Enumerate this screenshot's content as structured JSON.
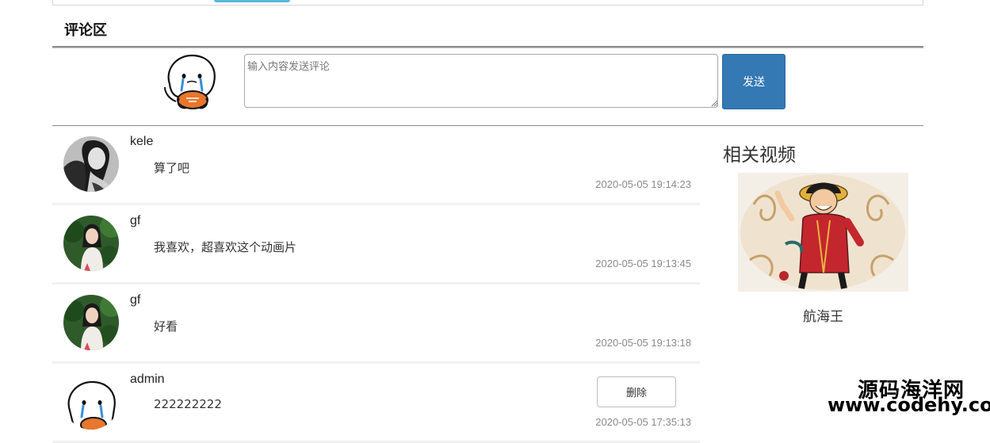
{
  "comment_section": {
    "title": "评论区",
    "input_placeholder": "输入内容发送评论",
    "send_label": "发送"
  },
  "comments": [
    {
      "user": "kele",
      "text": "算了吧",
      "time": "2020-05-05 19:14:23",
      "avatar": "woman-photo-bw"
    },
    {
      "user": "gf",
      "text": "我喜欢，超喜欢这个动画片",
      "time": "2020-05-05 19:13:45",
      "avatar": "woman-photo-green"
    },
    {
      "user": "gf",
      "text": "好看",
      "time": "2020-05-05 19:13:18",
      "avatar": "woman-photo-green"
    },
    {
      "user": "admin",
      "text": "222222222",
      "time": "2020-05-05 17:35:13",
      "avatar": "crying-cartoon",
      "delete_label": "删除"
    }
  ],
  "related": {
    "title": "相关视频",
    "video_name": "航海王",
    "thumbnail": "luffy-illustration"
  },
  "watermark": {
    "line1": "源码海洋网",
    "line2": "www.codehy.com"
  },
  "colors": {
    "accent": "#3478b4",
    "tab": "#5bb8d6",
    "time": "#8a8a8a"
  }
}
